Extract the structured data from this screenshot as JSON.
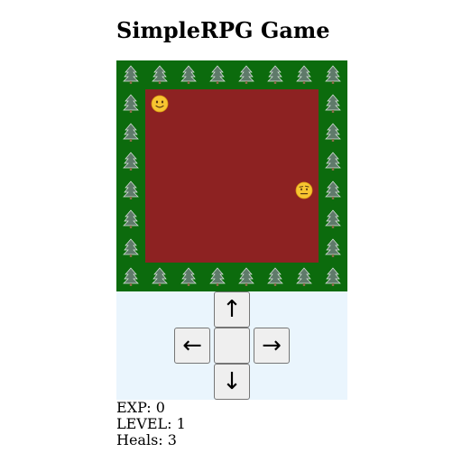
{
  "title": "SimpleRPG Game",
  "colors": {
    "grass": "#0c6b0d",
    "floor": "#8d2222",
    "controls_bg": "#eaf5fd"
  },
  "map": {
    "border_icon": "tree-icon",
    "player_icon": "smiley-face-icon",
    "enemy_icon": "skeptical-face-icon"
  },
  "controls": {
    "up": "↑",
    "left": "←",
    "center": "",
    "right": "→",
    "down": "↓"
  },
  "stats": {
    "exp_label": "EXP:",
    "exp": "0",
    "level_label": "LEVEL:",
    "level": "1",
    "heals_label": "Heals:",
    "heals": "3"
  }
}
